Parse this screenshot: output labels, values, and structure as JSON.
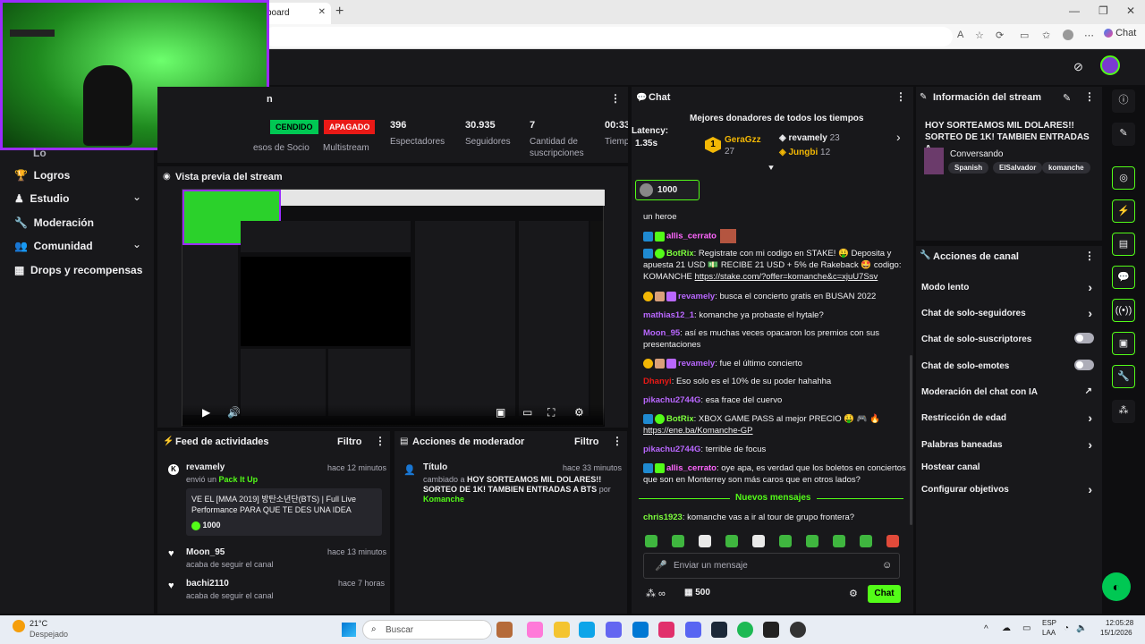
{
  "browser": {
    "tab_title": "board",
    "search_placeholder": "Buscar",
    "chat_label": "Chat",
    "url_icons": [
      "A",
      "☆"
    ]
  },
  "sidebar": {
    "items": [
      {
        "label": "Logros"
      },
      {
        "label": "Estudio"
      },
      {
        "label": "Moderación"
      },
      {
        "label": "Comunidad"
      },
      {
        "label": "Drops y recompensas"
      }
    ],
    "top_partial": "Lo"
  },
  "stats": {
    "title_partial": "n",
    "enc": "CENDIDO",
    "apagado": "APAGADO",
    "espectadores": "396",
    "espectadores_lbl": "Espectadores",
    "seguidores": "30.935",
    "seguidores_lbl": "Seguidores",
    "subs": "7",
    "subs_lbl": "Cantidad de suscripciones",
    "tiempo": "00:33",
    "tiempo_lbl": "Tiempo en vivo",
    "socio_lbl": "esos de Socio",
    "multistream_lbl": "Multistream"
  },
  "preview": {
    "title": "Vista previa del stream"
  },
  "activity": {
    "title": "Feed de actividades",
    "filter": "Filtro",
    "items": [
      {
        "user": "revamely",
        "time": "hace 12 minutos",
        "sub": "envió un",
        "sub_link": "Pack It Up",
        "message": "VE EL [MMA 2019] 방탄소년단(BTS) | Full Live Performance PARA QUE TE DES UNA IDEA",
        "amount": "1000"
      },
      {
        "user": "Moon_95",
        "time": "hace 13 minutos",
        "sub": "acaba de seguir el canal"
      },
      {
        "user": "bachi2110",
        "time": "hace 7 horas",
        "sub": "acaba de seguir el canal"
      }
    ]
  },
  "mod_actions": {
    "title": "Acciones de moderador",
    "filter": "Filtro",
    "item": {
      "label": "Título",
      "time": "hace 33 minutos",
      "desc": "cambiado a",
      "value": "HOY SORTEAMOS MIL DOLARES!! SORTEO DE 1K! TAMBIEN ENTRADAS A BTS",
      "by": "por",
      "author": "Komanche"
    }
  },
  "chat": {
    "title": "Chat",
    "latency_label": "Latency:",
    "latency_value": "1.35s",
    "donors_title": "Mejores donadores de todos los tiempos",
    "donors": [
      {
        "rank": "1",
        "name": "GeraGzz",
        "amount": "27"
      },
      {
        "name": "revamely",
        "amount": "23"
      },
      {
        "name": "Jungbi",
        "amount": "12"
      }
    ],
    "pinned_amount": "1000",
    "partial_top": "un heroe",
    "messages": [
      {
        "user": "allis_cerrato",
        "text": "",
        "color": "#ff66ff"
      },
      {
        "user": "BotRix",
        "text": "Registrate con mi codigo en STAKE! 🤑 Deposita y apuesta 21 USD 💵 RECIBE 21 USD + 5% de Rakeback 🤩 codigo: KOMANCHE",
        "link": "https://stake.com/?offer=komanche&c=xjuU7Ssv",
        "color": "#7cff3c"
      },
      {
        "user": "revamely",
        "text": "busca el concierto gratis en BUSAN 2022",
        "color": "#b967ff"
      },
      {
        "user": "mathias12_1",
        "text": "komanche ya probaste el hytale?",
        "color": "#b967ff"
      },
      {
        "user": "Moon_95",
        "text": "así es muchas veces opacaron los premios con sus presentaciones",
        "color": "#b967ff"
      },
      {
        "user": "revamely",
        "text": "fue el último concierto",
        "color": "#b967ff"
      },
      {
        "user": "Dhanyi",
        "text": "Eso solo es el 10% de su poder hahahha",
        "color": "#e91916"
      },
      {
        "user": "pikachu2744G",
        "text": "esa frace del cuervo",
        "color": "#b967ff"
      },
      {
        "user": "BotRix",
        "text": "XBOX GAME PASS al mejor PRECIO 🤑 🎮 🔥",
        "link": "https://ene.ba/Komanche-GP",
        "color": "#7cff3c"
      },
      {
        "user": "pikachu2744G",
        "text": "terrible de focus",
        "color": "#b967ff"
      },
      {
        "user": "allis_cerrato",
        "text": "oye apa, es verdad que los boletos en conciertos que son en Monterrey son más caros que en otros lados?",
        "color": "#ff66ff"
      }
    ],
    "new_messages": "Nuevos mensajes",
    "last": {
      "user": "chris1923",
      "text": "komanche vas a ir al tour de grupo frontera?",
      "color": "#7cff3c"
    },
    "input_placeholder": "Enviar un mensaje",
    "points": "500",
    "send": "Chat"
  },
  "stream_info": {
    "title": "Información del stream",
    "stream_title": "HOY SORTEAMOS MIL DOLARES!! SORTEO DE 1K! TAMBIEN ENTRADAS A...",
    "category": "Conversando",
    "tags": [
      "Spanish",
      "ElSalvador",
      "komanche"
    ]
  },
  "channel_actions": {
    "title": "Acciones de canal",
    "items": [
      {
        "label": "Modo lento",
        "control": "chev"
      },
      {
        "label": "Chat de solo-seguidores",
        "control": "chev"
      },
      {
        "label": "Chat de solo-suscriptores",
        "control": "toggle"
      },
      {
        "label": "Chat de solo-emotes",
        "control": "toggle"
      },
      {
        "label": "Moderación del chat con IA",
        "control": "ext"
      },
      {
        "label": "Restricción de edad",
        "control": "chev"
      },
      {
        "label": "Palabras baneadas",
        "control": "chev"
      },
      {
        "label": "Hostear canal",
        "control": "none"
      },
      {
        "label": "Configurar objetivos",
        "control": "chev"
      }
    ]
  },
  "taskbar": {
    "temp": "21°C",
    "weather": "Despejado",
    "search": "Buscar",
    "lang1": "ESP",
    "lang2": "LAA",
    "time": "12:05:28",
    "date": "15/1/2026"
  },
  "colors": {
    "accent": "#53fc18",
    "bg": "#0e0e10",
    "panel": "#18181b"
  }
}
